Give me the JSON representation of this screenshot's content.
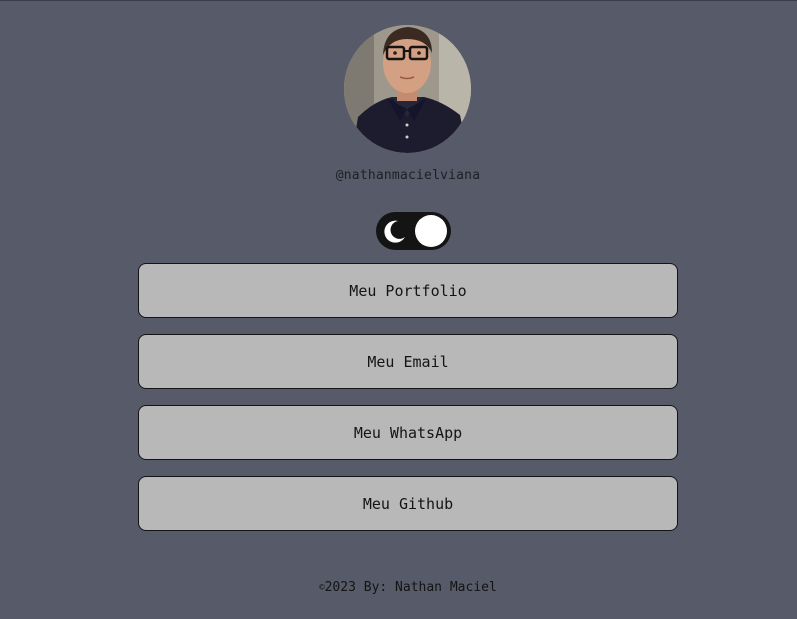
{
  "profile": {
    "avatar_icon": "profile-photo",
    "username": "@nathanmacielviana"
  },
  "theme_toggle": {
    "icon": "moon-icon",
    "state": "dark"
  },
  "links": [
    {
      "label": "Meu Portfolio"
    },
    {
      "label": "Meu Email"
    },
    {
      "label": "Meu WhatsApp"
    },
    {
      "label": "Meu Github"
    }
  ],
  "footer": {
    "copyright_symbol": "©",
    "text": "2023 By: Nathan Maciel"
  },
  "colors": {
    "background": "#575b69",
    "button": "#b8b8b8",
    "button_border": "#141414",
    "toggle": "#141414",
    "knob": "#ffffff"
  }
}
